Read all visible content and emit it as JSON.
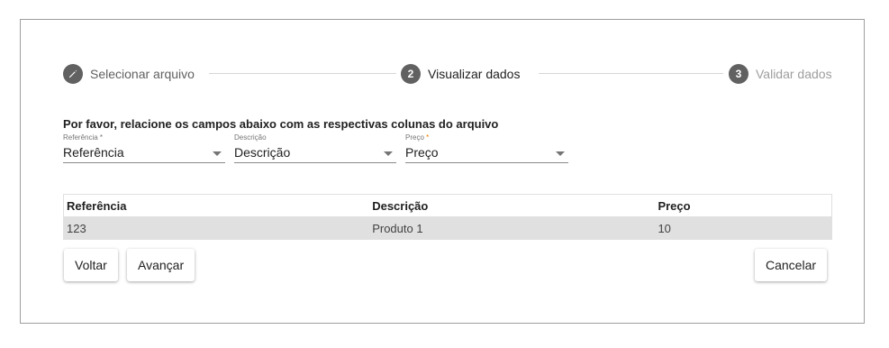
{
  "stepper": {
    "steps": [
      {
        "number": "",
        "label": "Selecionar arquivo",
        "state": "done",
        "icon": "pencil-icon"
      },
      {
        "number": "2",
        "label": "Visualizar dados",
        "state": "active"
      },
      {
        "number": "3",
        "label": "Validar dados",
        "state": "future"
      }
    ]
  },
  "instruction": "Por favor, relacione os campos abaixo com as respectivas colunas do arquivo",
  "fields": [
    {
      "label": "Referência",
      "required_mark": "*",
      "value": "Referência"
    },
    {
      "label": "Descrição",
      "required_mark": "",
      "value": "Descrição"
    },
    {
      "label": "Preço",
      "required_mark": "*",
      "value": "Preço"
    }
  ],
  "table": {
    "headers": [
      "Referência",
      "Descrição",
      "Preço"
    ],
    "rows": [
      [
        "123",
        "Produto 1",
        "10"
      ]
    ]
  },
  "buttons": {
    "back": "Voltar",
    "next": "Avançar",
    "cancel": "Cancelar"
  },
  "colors": {
    "accent_required": "#f57c00",
    "row_highlight": "#e0e0e0",
    "step_circle": "#616161"
  }
}
